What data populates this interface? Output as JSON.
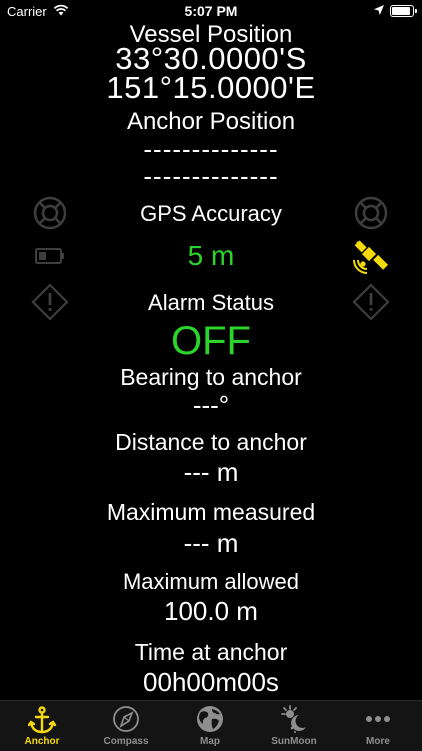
{
  "status_bar": {
    "carrier": "Carrier",
    "time": "5:07 PM",
    "battery_level": 0.9
  },
  "vessel": {
    "heading": "Vessel Position",
    "lat": "33°30.0000'S",
    "lon": "151°15.0000'E"
  },
  "anchor": {
    "heading": "Anchor Position",
    "lat": "--------------",
    "lon": "--------------"
  },
  "gps": {
    "label": "GPS Accuracy",
    "value": "5 m",
    "value_color": "#2bd42b"
  },
  "alarm": {
    "label": "Alarm Status",
    "value": "OFF",
    "value_color": "#2bd42b"
  },
  "bearing": {
    "label": "Bearing to anchor",
    "value": "---°"
  },
  "distance": {
    "label": "Distance to anchor",
    "value": "--- m"
  },
  "max_measured": {
    "label": "Maximum measured",
    "value": "--- m"
  },
  "max_allowed": {
    "label": "Maximum allowed",
    "value": "100.0 m"
  },
  "time_at_anchor": {
    "label": "Time at anchor",
    "value": "00h00m00s"
  },
  "side_icons": {
    "left": [
      "lifebuoy-icon",
      "battery-icon",
      "warning-icon"
    ],
    "right": [
      "lifebuoy-icon",
      "satellite-icon",
      "warning-icon"
    ],
    "satellite_color": "#f5d90a"
  },
  "tabs": [
    {
      "label": "Anchor",
      "icon": "anchor-icon",
      "active": true
    },
    {
      "label": "Compass",
      "icon": "compass-icon",
      "active": false
    },
    {
      "label": "Map",
      "icon": "globe-icon",
      "active": false
    },
    {
      "label": "SunMoon",
      "icon": "sun-moon-icon",
      "active": false
    },
    {
      "label": "More",
      "icon": "more-icon",
      "active": false
    }
  ]
}
